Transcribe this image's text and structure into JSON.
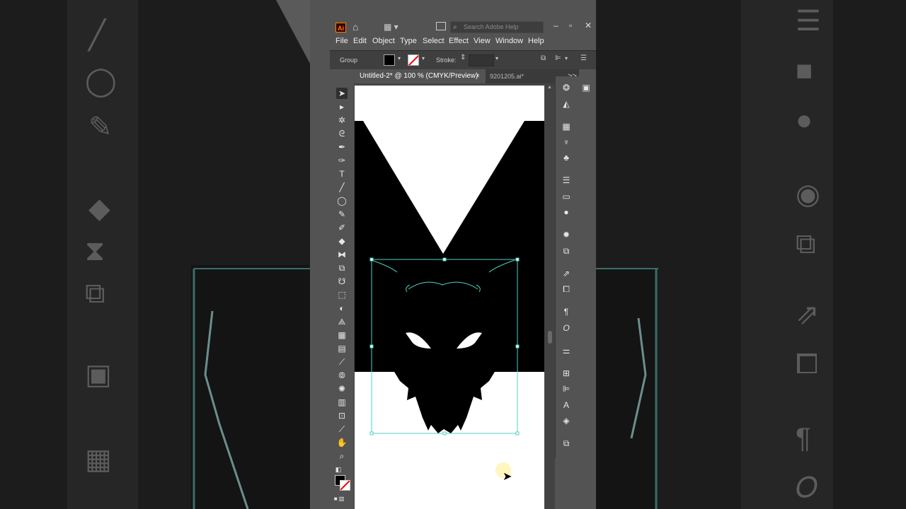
{
  "app": {
    "logo": "Ai",
    "search_placeholder": "Search Adobe Help"
  },
  "menu": [
    "File",
    "Edit",
    "Object",
    "Type",
    "Select",
    "Effect",
    "View",
    "Window",
    "Help"
  ],
  "control_bar": {
    "selection_label": "Group",
    "stroke_label": "Stroke:"
  },
  "tabs": {
    "active": "Untitled-2* @ 100 % (CMYK/Preview)",
    "inactive": "9201205.ai*",
    "close": "×",
    "more": ">>"
  },
  "colors": {
    "fill": "#000000",
    "stroke": "none",
    "selection": "#4fd1c5",
    "accent": "#ff7c00"
  },
  "icons": {
    "tools": [
      "selection-icon",
      "direct-selection-icon",
      "magic-wand-icon",
      "lasso-icon",
      "pen-icon",
      "curvature-icon",
      "type-icon",
      "line-icon",
      "ellipse-icon",
      "paintbrush-icon",
      "shaper-icon",
      "eraser-icon",
      "rotate-icon",
      "scale-icon",
      "warp-icon",
      "free-transform-icon",
      "shape-builder-icon",
      "perspective-icon",
      "mesh-icon",
      "gradient-icon",
      "eyedropper-icon",
      "blend-icon",
      "symbol-sprayer-icon",
      "column-graph-icon",
      "artboard-icon",
      "slice-icon",
      "hand-icon",
      "zoom-icon"
    ],
    "panels": [
      "color-guide-icon",
      "color-icon",
      "swatches-icon",
      "brushes-icon",
      "symbols-icon",
      "stroke-icon",
      "gradient-icon",
      "transparency-icon",
      "appearance-icon",
      "graphic-styles-icon",
      "export-icon",
      "transform-icon",
      "paragraph-icon",
      "opentype-icon",
      "properties-icon",
      "align-icon",
      "pathfinder-icon",
      "character-icon",
      "layers-icon",
      "artboards-icon"
    ]
  }
}
